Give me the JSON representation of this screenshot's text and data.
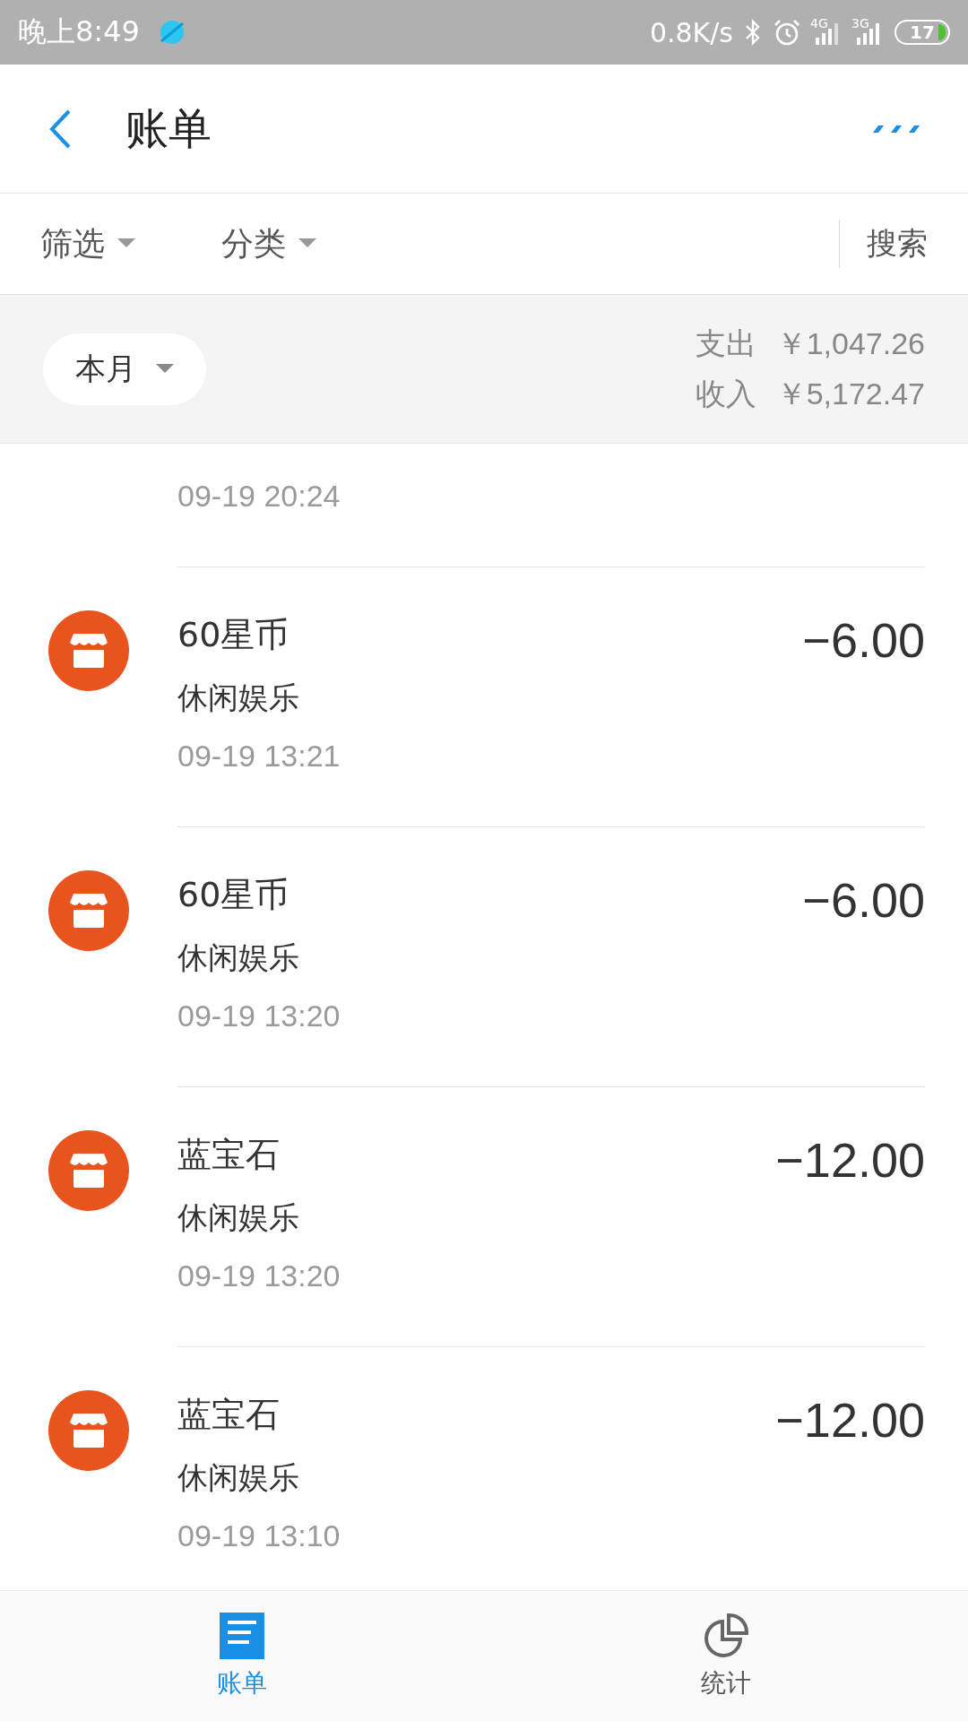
{
  "status_bar": {
    "time": "晚上8:49",
    "speed": "0.8K/s",
    "net1": "4G",
    "net2": "3G",
    "battery": "17"
  },
  "header": {
    "title": "账单"
  },
  "filters": [
    {
      "label": "筛选"
    },
    {
      "label": "分类"
    }
  ],
  "search": {
    "label": "搜索"
  },
  "summary": {
    "period": "本月",
    "expense_label": "支出",
    "expense": "￥1,047.26",
    "income_label": "收入",
    "income": "￥5,172.47"
  },
  "partial_row": {
    "time": "09-19  20:24"
  },
  "transactions": [
    {
      "title": "60星币",
      "category": "休闲娱乐",
      "time": "09-19  13:21",
      "amount": "−6.00"
    },
    {
      "title": "60星币",
      "category": "休闲娱乐",
      "time": "09-19  13:20",
      "amount": "−6.00"
    },
    {
      "title": "蓝宝石",
      "category": "休闲娱乐",
      "time": "09-19  13:20",
      "amount": "−12.00"
    },
    {
      "title": "蓝宝石",
      "category": "休闲娱乐",
      "time": "09-19  13:10",
      "amount": "−12.00"
    }
  ],
  "tabs": [
    {
      "label": "账单",
      "kind": "bill",
      "selected": true
    },
    {
      "label": "统计",
      "kind": "stats",
      "selected": false
    }
  ]
}
